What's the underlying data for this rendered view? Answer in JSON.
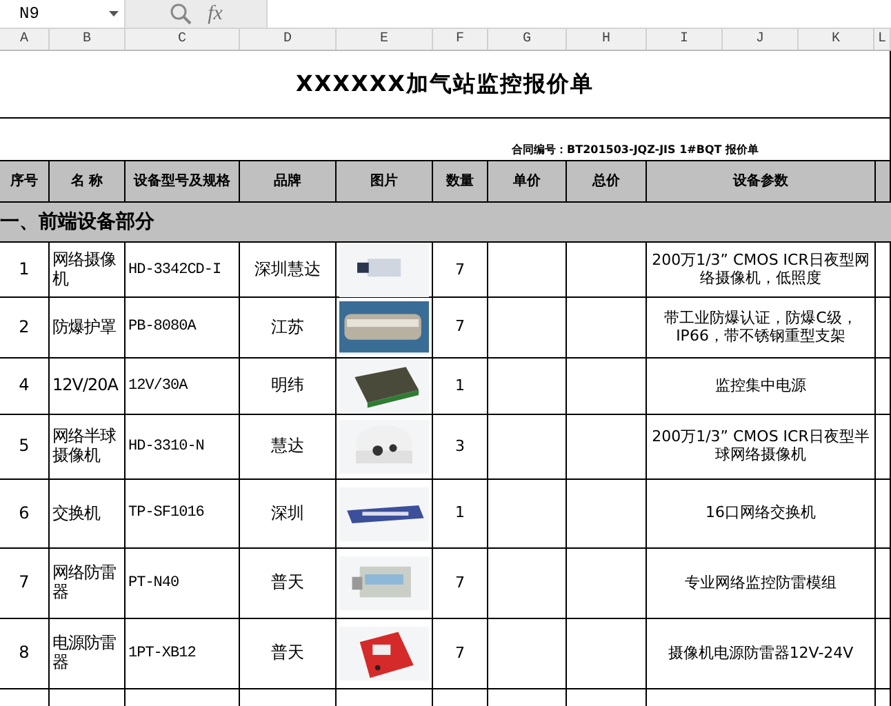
{
  "formula_bar": {
    "name_box": "N9",
    "function_label": "fx"
  },
  "column_headers": [
    "A",
    "B",
    "C",
    "D",
    "E",
    "F",
    "G",
    "H",
    "I",
    "J",
    "K",
    "L"
  ],
  "title": "XXXXXX加气站监控报价单",
  "contract": "合同编号：BT201503-JQZ-JIS 1#BQT 报价单",
  "table": {
    "columns": [
      "序号",
      "名 称",
      "设备型号及规格",
      "品牌",
      "图片",
      "数量",
      "单价",
      "总价",
      "设备参数"
    ],
    "section": "一、前端设备部分",
    "rows": [
      {
        "no": "1",
        "name": "网络摄像机",
        "model": "HD-3342CD-I",
        "brand": "深圳慧达",
        "qty": "7",
        "params": "200万1/3” CMOS ICR日夜型网络摄像机，低照度"
      },
      {
        "no": "2",
        "name": "防爆护罩",
        "model": "PB-8080A",
        "brand": "江苏",
        "qty": "7",
        "params": "带工业防爆认证，防爆C级，IP66，带不锈钢重型支架"
      },
      {
        "no": "4",
        "name": "12V/20A",
        "model": "12V/30A",
        "brand": "明纬",
        "qty": "1",
        "params": "监控集中电源"
      },
      {
        "no": "5",
        "name": "网络半球摄像机",
        "model": "HD-3310-N",
        "brand": "慧达",
        "qty": "3",
        "params": "200万1/3” CMOS ICR日夜型半球网络摄像机"
      },
      {
        "no": "6",
        "name": "交换机",
        "model": "TP-SF1016",
        "brand": "深圳",
        "qty": "1",
        "params": "16口网络交换机"
      },
      {
        "no": "7",
        "name": "网络防雷器",
        "model": "PT-N40",
        "brand": "普天",
        "qty": "7",
        "params": "专业网络监控防雷模组"
      },
      {
        "no": "8",
        "name": "电源防雷器",
        "model": "1PT-XB12",
        "brand": "普天",
        "qty": "7",
        "params": "摄像机电源防雷器12V-24V"
      }
    ]
  }
}
